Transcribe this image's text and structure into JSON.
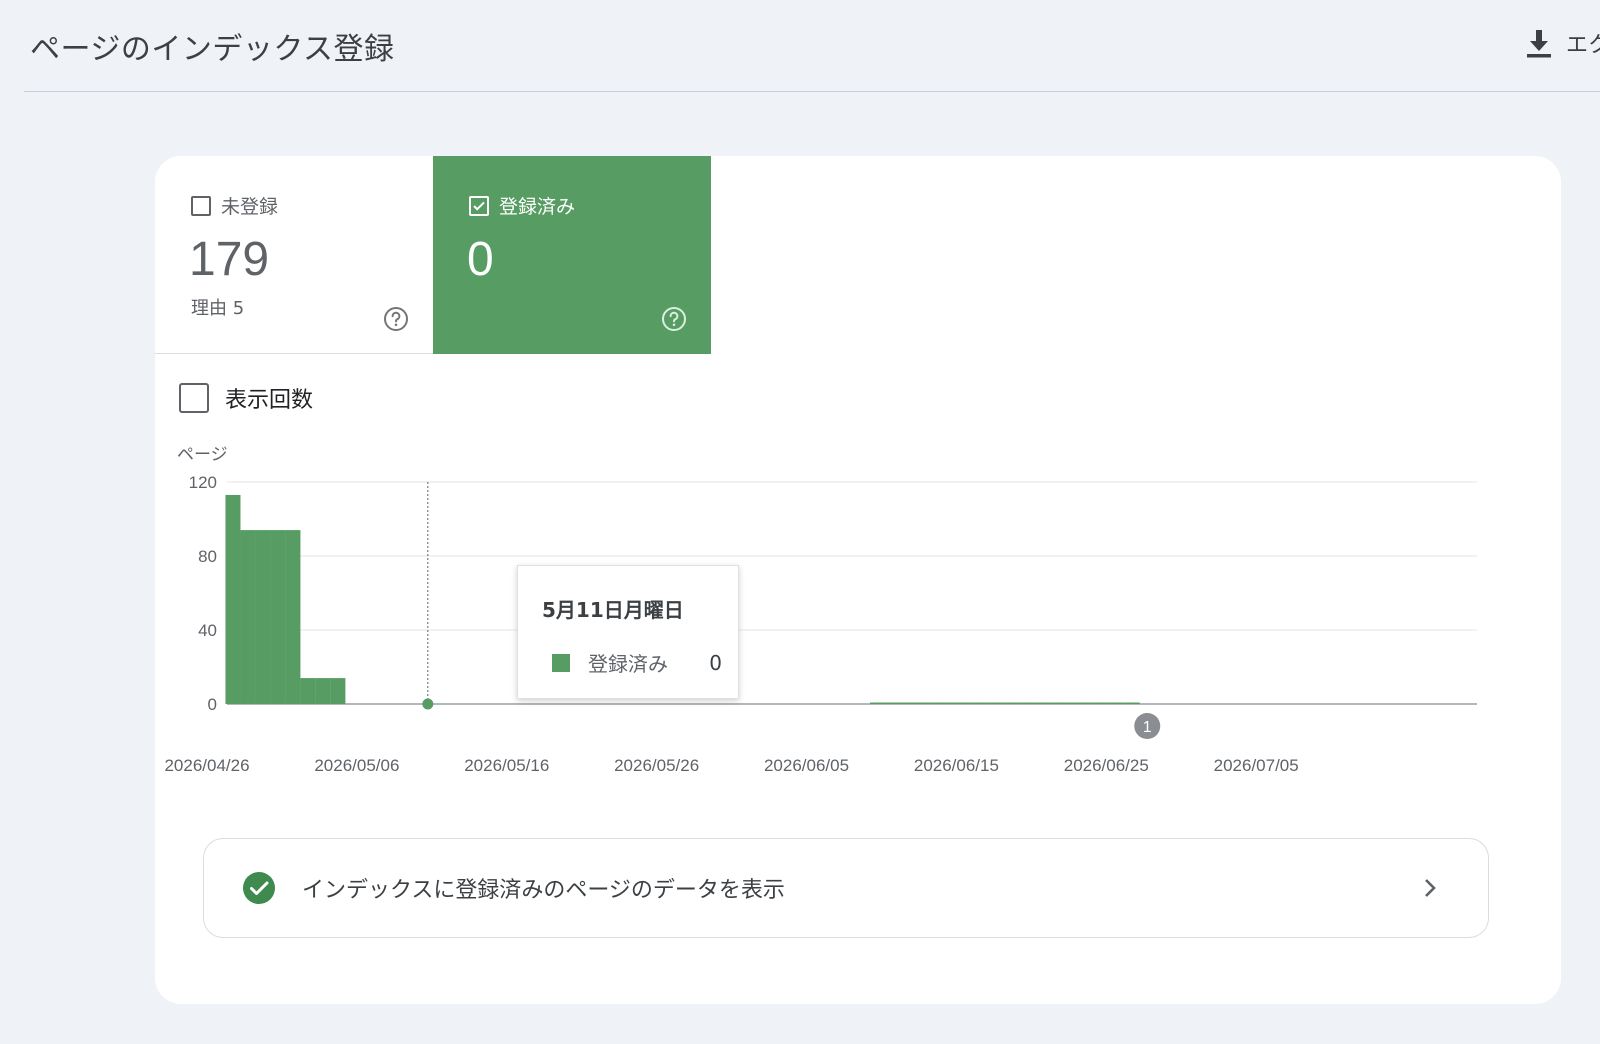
{
  "header": {
    "title": "ページのインデックス登録",
    "export_label": "エク"
  },
  "metrics": {
    "unindexed": {
      "label": "未登録",
      "value": "179",
      "sub": "理由 5",
      "checked": false
    },
    "indexed": {
      "label": "登録済み",
      "value": "0",
      "checked": true
    }
  },
  "impressions": {
    "label": "表示回数",
    "checked": false
  },
  "tooltip": {
    "date": "5月11日月曜日",
    "series": "登録済み",
    "value": "0"
  },
  "link": {
    "label": "インデックスに登録済みのページのデータを表示"
  },
  "colors": {
    "indexed": "#579c62",
    "link_check": "#3e8a4f"
  },
  "chart_data": {
    "type": "bar",
    "ylabel": "ページ",
    "ylim": [
      0,
      120
    ],
    "yticks": [
      "0",
      "40",
      "80",
      "120"
    ],
    "xtick_labels": [
      "2026/04/26",
      "2026/05/06",
      "2026/05/16",
      "2026/05/26",
      "2026/06/05",
      "2026/06/15",
      "2026/06/25",
      "2026/07/05"
    ],
    "start_date": "2026-04-26",
    "end_date": "2026-07-20",
    "series": [
      {
        "name": "登録済み",
        "values": [
          {
            "date": "2026-04-28",
            "value": 113
          },
          {
            "date": "2026-04-29",
            "value": 94
          },
          {
            "date": "2026-04-30",
            "value": 94
          },
          {
            "date": "2026-05-01",
            "value": 94
          },
          {
            "date": "2026-05-02",
            "value": 94
          },
          {
            "date": "2026-05-03",
            "value": 14
          },
          {
            "date": "2026-05-04",
            "value": 14
          },
          {
            "date": "2026-05-05",
            "value": 14
          },
          {
            "date": "2026-06-10",
            "value": 0.8
          },
          {
            "date": "2026-06-11",
            "value": 0.8
          },
          {
            "date": "2026-06-12",
            "value": 0.8
          },
          {
            "date": "2026-06-13",
            "value": 0.8
          },
          {
            "date": "2026-06-14",
            "value": 0.8
          },
          {
            "date": "2026-06-15",
            "value": 0.8
          },
          {
            "date": "2026-06-16",
            "value": 0.8
          },
          {
            "date": "2026-06-17",
            "value": 0.8
          },
          {
            "date": "2026-06-18",
            "value": 0.8
          },
          {
            "date": "2026-06-19",
            "value": 0.8
          },
          {
            "date": "2026-06-20",
            "value": 0.8
          },
          {
            "date": "2026-06-21",
            "value": 0.8
          },
          {
            "date": "2026-06-22",
            "value": 0.8
          },
          {
            "date": "2026-06-23",
            "value": 0.8
          },
          {
            "date": "2026-06-24",
            "value": 0.8
          },
          {
            "date": "2026-06-25",
            "value": 0.8
          },
          {
            "date": "2026-06-26",
            "value": 0.8
          },
          {
            "date": "2026-06-27",
            "value": 0.8
          }
        ]
      }
    ],
    "hover_date": "2026-05-11",
    "annotations": [
      {
        "label": "1",
        "date": "2026-06-28"
      }
    ]
  }
}
